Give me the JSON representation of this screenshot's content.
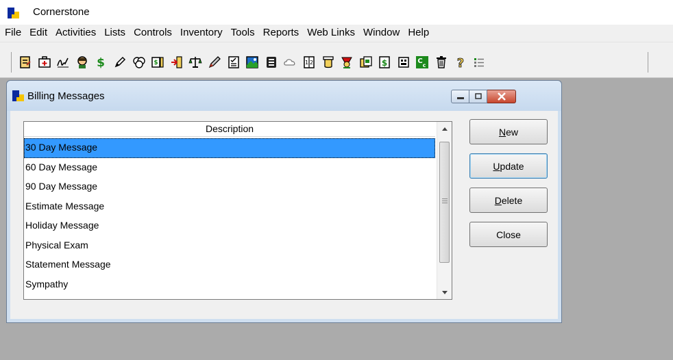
{
  "app": {
    "title": "Cornerstone"
  },
  "menu": [
    "File",
    "Edit",
    "Activities",
    "Lists",
    "Controls",
    "Inventory",
    "Tools",
    "Reports",
    "Web Links",
    "Window",
    "Help"
  ],
  "toolbar_icons": [
    "notes-icon",
    "first-aid-icon",
    "signature-icon",
    "patient-icon",
    "dollar-icon",
    "edit-icon",
    "clipboard-icon",
    "invoice-icon",
    "checkin-icon",
    "scale-icon",
    "pen-icon",
    "checklist-icon",
    "image-icon",
    "record-icon",
    "cloud-icon",
    "calculator-icon",
    "lab-icon",
    "award-icon",
    "document-icon",
    "payment-icon",
    "grid-icon",
    "cc-icon",
    "trash-icon",
    "help-icon",
    "list-icon"
  ],
  "dialog": {
    "title": "Billing Messages",
    "list": {
      "header": "Description",
      "rows": [
        "30 Day Message",
        "60 Day Message",
        "90 Day Message",
        "Estimate Message",
        "Holiday Message",
        "Physical Exam",
        "Statement Message",
        "Sympathy"
      ],
      "selected_index": 0
    },
    "buttons": {
      "new": {
        "accel": "N",
        "rest": "ew"
      },
      "update": {
        "accel": "U",
        "rest": "pdate"
      },
      "delete": {
        "accel": "D",
        "rest": "elete"
      },
      "close": {
        "label": "Close"
      }
    }
  },
  "colors": {
    "selection": "#3399ff",
    "workspace": "#ababab",
    "dialog_frame": "#cfdff0",
    "close_button": "#c8472f"
  }
}
